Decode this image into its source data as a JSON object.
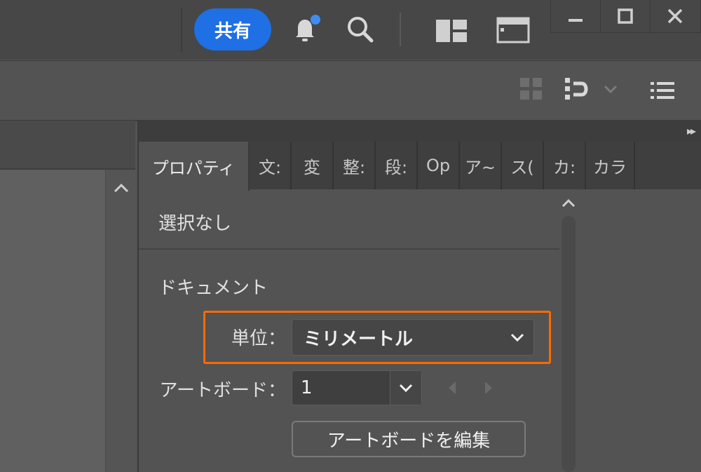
{
  "titlebar": {
    "share_label": "共有",
    "icons": [
      "bell-icon",
      "search-icon",
      "workspace-layout-icon",
      "panel-toggle-icon"
    ],
    "window_controls": [
      "minimize-icon",
      "maximize-icon",
      "close-icon"
    ]
  },
  "toolbar": {
    "icons": [
      "grid-align-icon",
      "snap-icon",
      "chevron-down-icon",
      "list-icon"
    ]
  },
  "panel": {
    "tabs": [
      "プロパティ",
      "文:",
      "変",
      "整:",
      "段:",
      "Op",
      "ア~",
      "ス(",
      "カ:",
      "カラ"
    ],
    "selection_text": "選択なし",
    "document_heading": "ドキュメント",
    "units_label": "単位：",
    "units_value": "ミリメートル",
    "artboard_label": "アートボード：",
    "artboard_value": "1",
    "edit_artboard_button": "アートボードを編集"
  },
  "colors": {
    "accent": "#1f6fe5",
    "highlight": "#ff6a00",
    "notification_dot": "#3d8ef0"
  }
}
